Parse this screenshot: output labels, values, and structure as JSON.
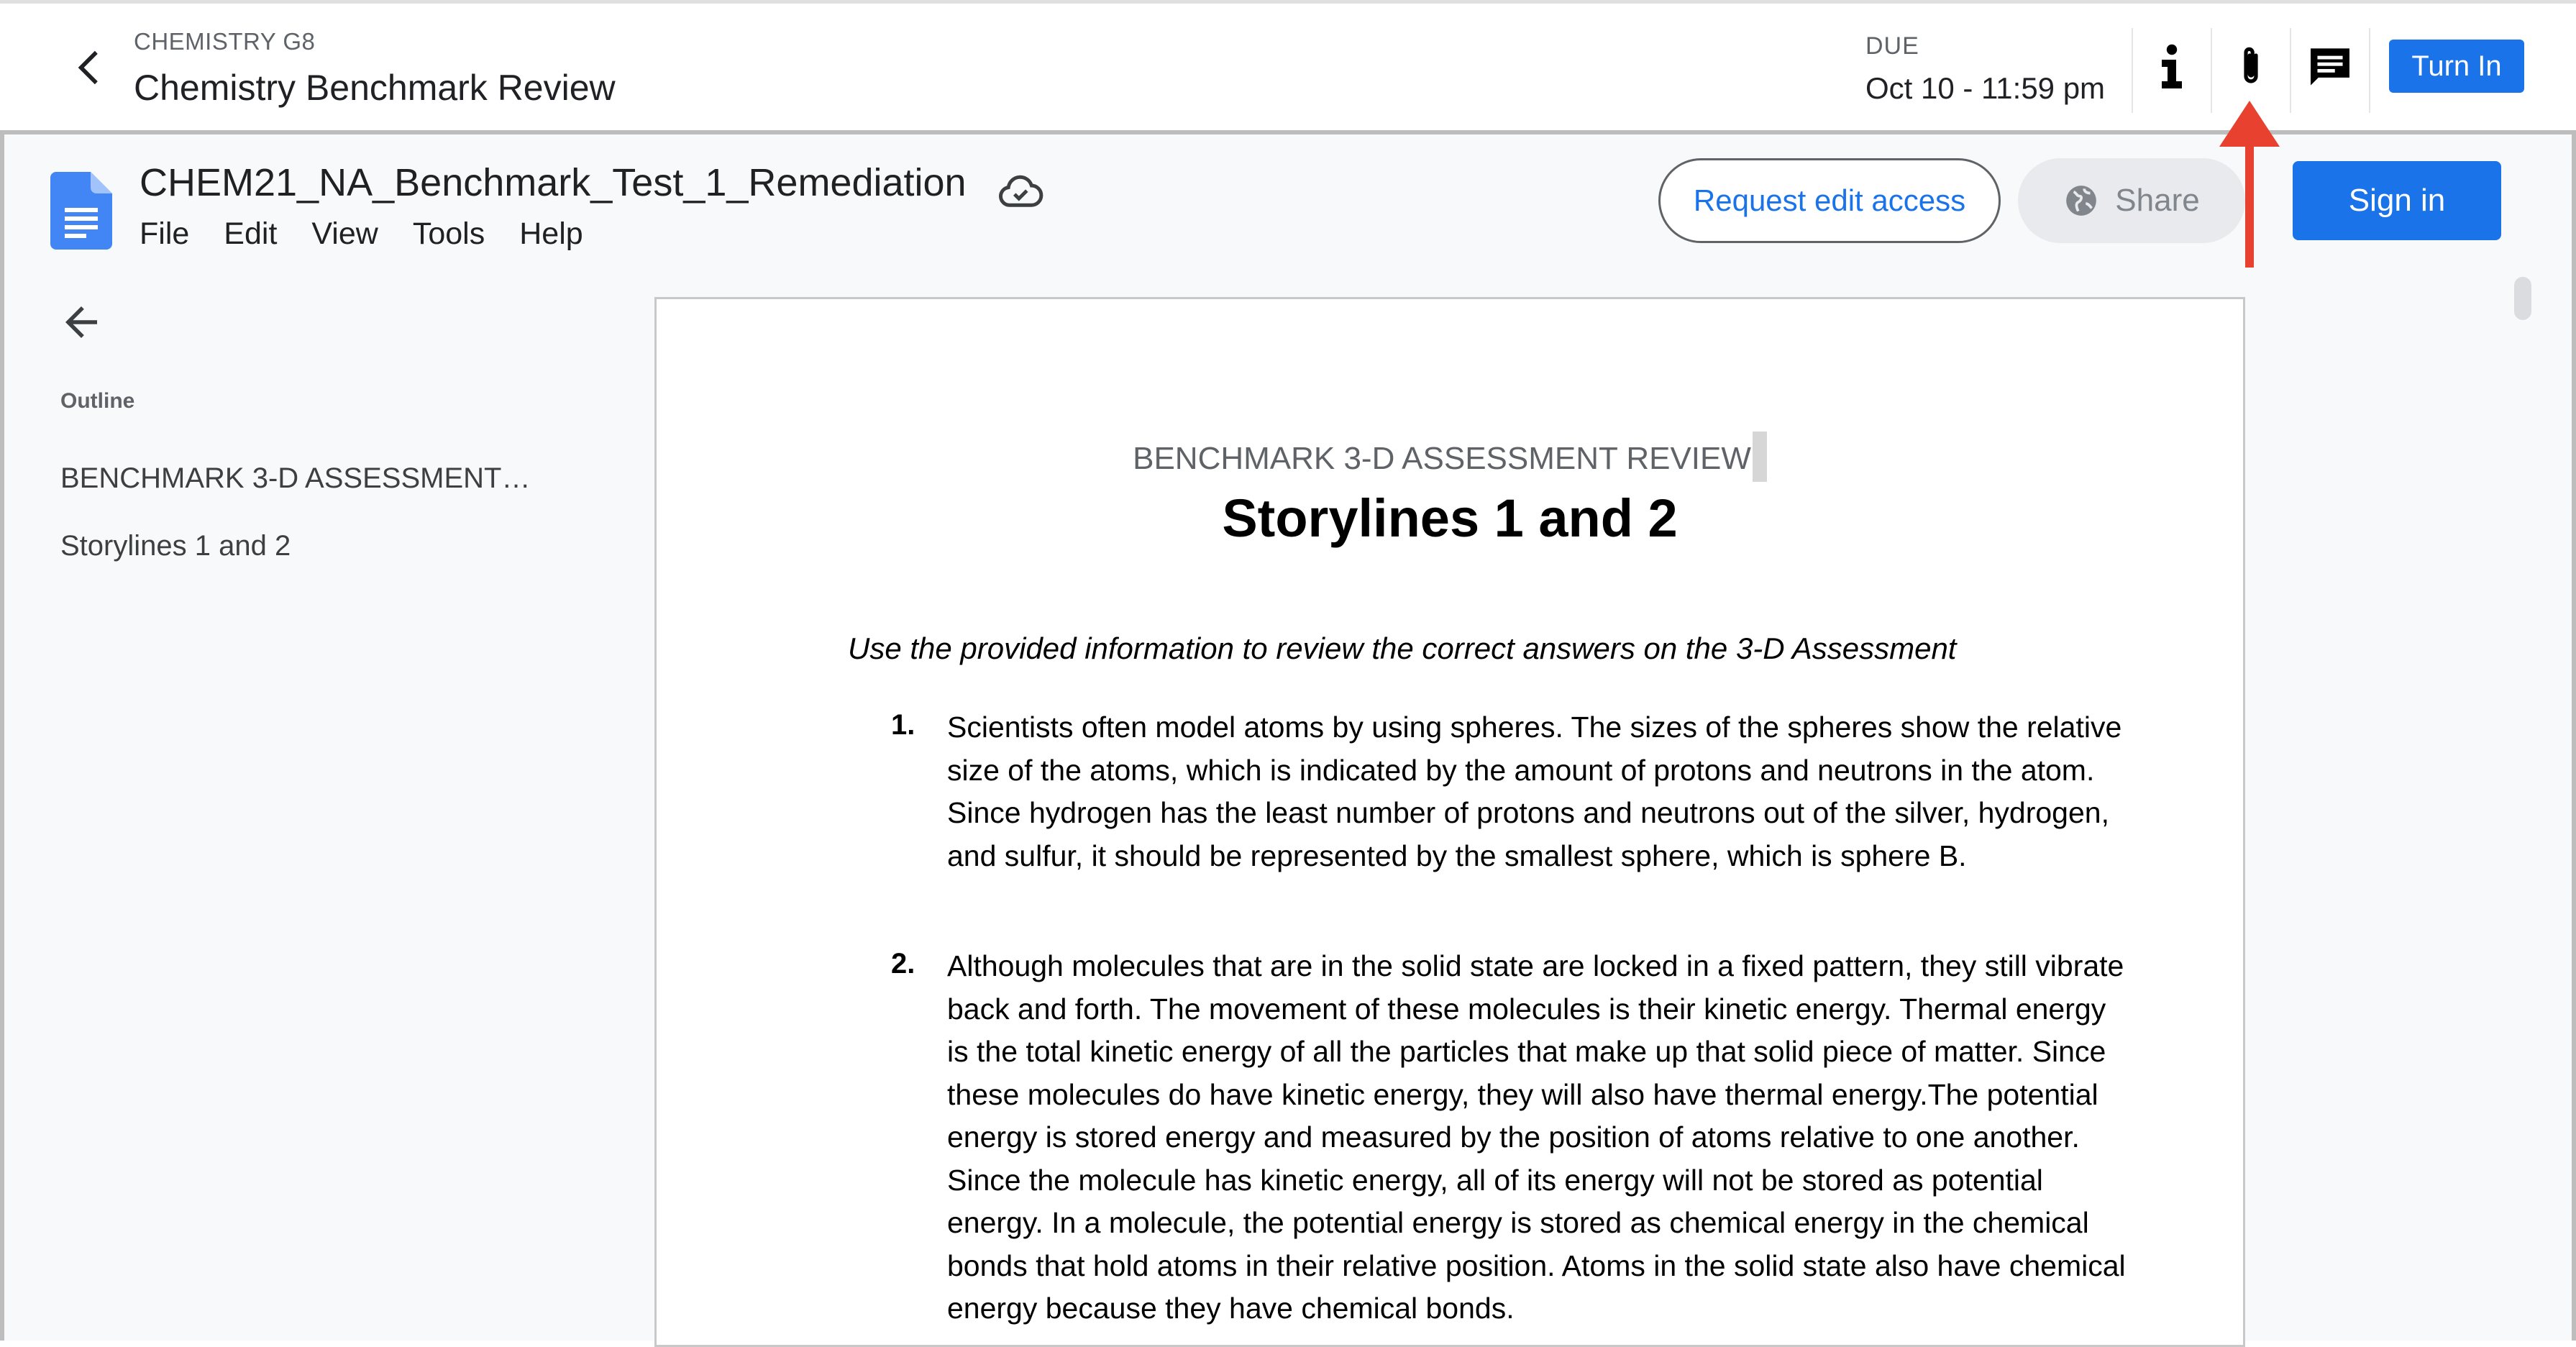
{
  "header": {
    "course": "CHEMISTRY G8",
    "title": "Chemistry Benchmark Review",
    "due_label": "DUE",
    "due_value": "Oct 10 - 11:59 pm",
    "turn_in_label": "Turn In"
  },
  "docs": {
    "doc_title": "CHEM21_NA_Benchmark_Test_1_Remediation",
    "menu": [
      "File",
      "Edit",
      "View",
      "Tools",
      "Help"
    ],
    "request_edit_label": "Request edit access",
    "share_label": "Share",
    "sign_in_label": "Sign in"
  },
  "outline": {
    "label": "Outline",
    "items": [
      "BENCHMARK 3-D ASSESSMENT…",
      "Storylines 1 and 2"
    ]
  },
  "page": {
    "subtitle": "BENCHMARK 3-D ASSESSMENT REVIEW",
    "title": "Storylines 1 and 2",
    "intro": "Use the provided information to review the correct answers on the 3-D Assessment",
    "questions": [
      {
        "num": "1.",
        "text": "Scientists often model atoms by using spheres. The sizes of the spheres show the relative size of the atoms, which is indicated by the amount of protons and neutrons in the atom. Since hydrogen has the least number of protons and neutrons out of the silver, hydrogen, and sulfur, it should be represented by the smallest sphere, which is sphere B."
      },
      {
        "num": "2.",
        "text": "Although molecules that are in the solid state are locked in a fixed pattern, they still vibrate back and forth. The movement of these molecules is their kinetic energy. Thermal energy is the total kinetic energy of all the particles that make up that solid piece of matter. Since these molecules do have kinetic energy, they will also have thermal energy.The potential energy is stored energy and measured by the position of atoms relative to one another. Since the molecule has kinetic energy, all of its energy will not be stored as potential energy. In a molecule, the potential energy is stored as chemical energy in the chemical bonds that hold atoms in their relative position. Atoms in the solid state also have chemical energy because they have chemical bonds."
      }
    ]
  },
  "colors": {
    "accent": "#1a73e8",
    "annotation": "#e8412f"
  }
}
